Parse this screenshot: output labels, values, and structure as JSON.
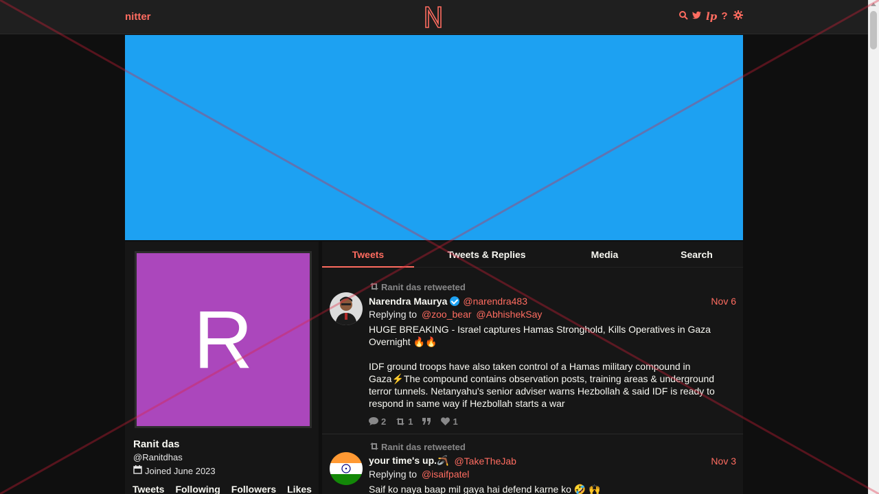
{
  "navbar": {
    "brand": "nitter",
    "icons": [
      "search-icon",
      "twitter-bird-icon",
      "rss-icon",
      "help-icon",
      "gear-icon"
    ],
    "accent_color": "#ff6c60"
  },
  "banner": {
    "color": "#1da1f2"
  },
  "profile": {
    "avatar_letter": "R",
    "avatar_color": "#ab47bc",
    "fullname": "Ranit das",
    "username": "@Ranitdhas",
    "joined": "Joined June 2023",
    "stats": [
      "Tweets",
      "Following",
      "Followers",
      "Likes"
    ]
  },
  "tabs": [
    {
      "label": "Tweets",
      "active": true
    },
    {
      "label": "Tweets & Replies",
      "active": false
    },
    {
      "label": "Media",
      "active": false
    },
    {
      "label": "Search",
      "active": false
    }
  ],
  "tweets": [
    {
      "retweet_header": "Ranit das retweeted",
      "fullname": "Narendra Maurya",
      "verified": true,
      "username": "@narendra483",
      "date": "Nov 6",
      "replying_label": "Replying to",
      "replying_to": [
        "@zoo_bear",
        "@AbhishekSay"
      ],
      "text": "HUGE BREAKING - Israel captures Hamas Stronghold, Kills Operatives in Gaza Overnight 🔥🔥\n\nIDF ground troops have also taken control of a Hamas military compound in Gaza⚡️The compound contains observation posts, training areas & underground terror tunnels. Netanyahu's senior adviser warns Hezbollah & said IDF is ready to respond in same way if Hezbollah starts a war",
      "stats": {
        "comments": "2",
        "retweets": "1",
        "quotes": "",
        "likes": "1"
      }
    },
    {
      "retweet_header": "Ranit das retweeted",
      "fullname": "your time's up.🪃",
      "verified": false,
      "username": "@TakeTheJab",
      "date": "Nov 3",
      "replying_label": "Replying to",
      "replying_to": [
        "@isaifpatel"
      ],
      "text": "Saif ko naya baap mil gaya hai defend karne ko 🤣 🙌",
      "stats": {
        "comments": "",
        "retweets": "",
        "quotes": "",
        "likes": ""
      }
    }
  ]
}
